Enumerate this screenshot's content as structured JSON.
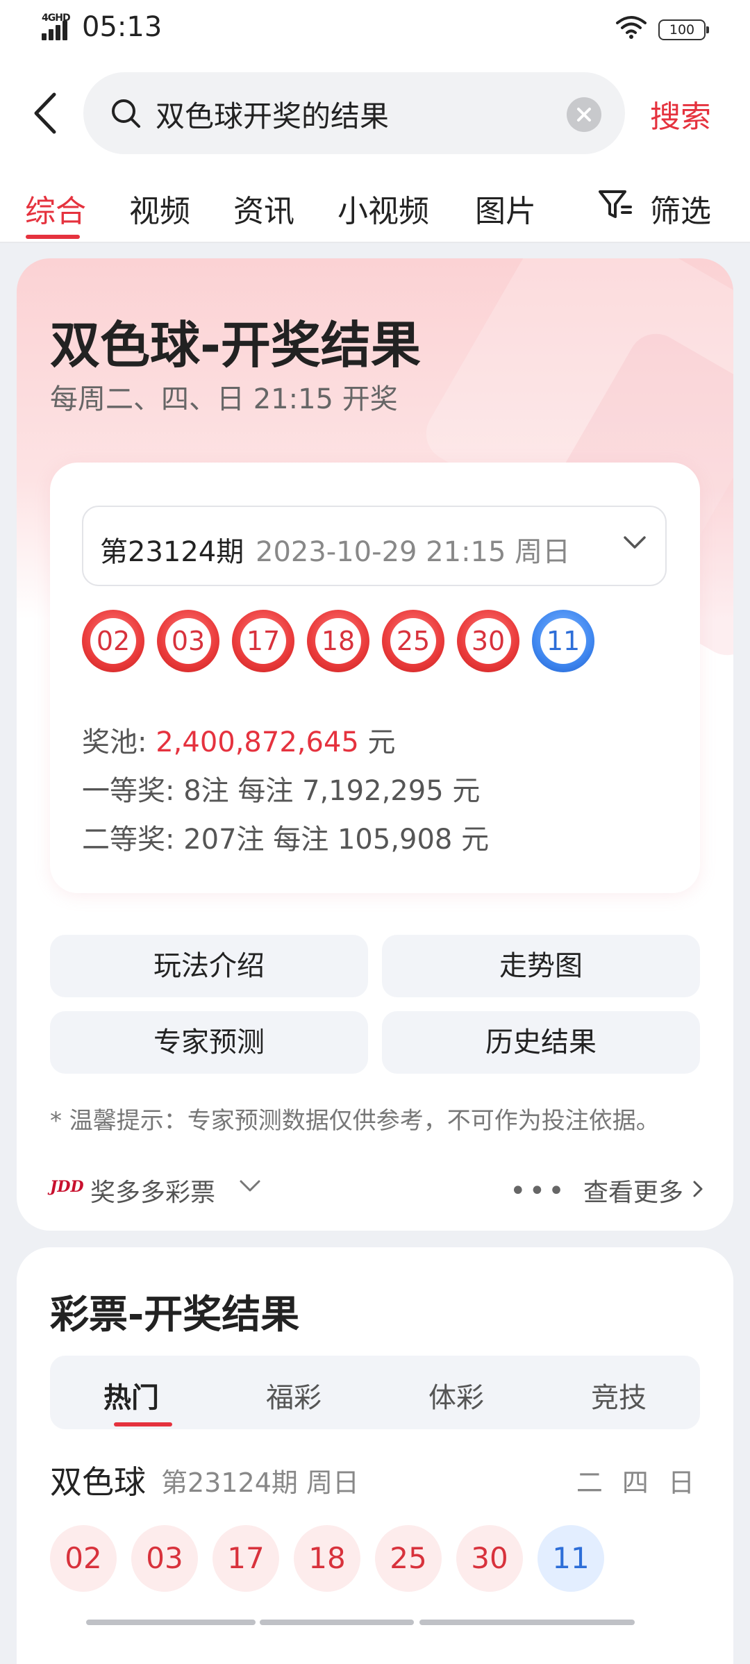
{
  "status": {
    "network": "4GHD",
    "time": "05:13",
    "battery": "100"
  },
  "search": {
    "query": "双色球开奖的结果",
    "submit_label": "搜索"
  },
  "tabs": [
    "综合",
    "视频",
    "资讯",
    "小视频",
    "图片"
  ],
  "filter_label": "筛选",
  "lottery_card": {
    "title": "双色球-开奖结果",
    "subtitle": "每周二、四、日 21:15 开奖",
    "issue": "第23124期",
    "issue_date": "2023-10-29 21:15 周日",
    "red_balls": [
      "02",
      "03",
      "17",
      "18",
      "25",
      "30"
    ],
    "blue_ball": "11",
    "pool_label": "奖池: ",
    "pool_value": "2,400,872,645",
    "pool_unit": " 元",
    "first_prize": "一等奖: 8注 每注 7,192,295 元",
    "second_prize": "二等奖: 207注 每注 105,908 元",
    "buttons": [
      "玩法介绍",
      "走势图",
      "专家预测",
      "历史结果"
    ],
    "tip": "* 温馨提示：专家预测数据仅供参考，不可作为投注依据。",
    "source_logo": "JDD",
    "source_name": "奖多多彩票",
    "more_dots": "•••",
    "more_label": "查看更多"
  },
  "results_card": {
    "title": "彩票-开奖结果",
    "categories": [
      "热门",
      "福彩",
      "体彩",
      "竞技"
    ],
    "lottery_name": "双色球",
    "lottery_issue": "第23124期 周日",
    "draw_days": "二 四 日",
    "red_balls": [
      "02",
      "03",
      "17",
      "18",
      "25",
      "30"
    ],
    "blue_ball": "11"
  },
  "colors": {
    "accent": "#e5323e",
    "blue": "#2d6ed8"
  }
}
